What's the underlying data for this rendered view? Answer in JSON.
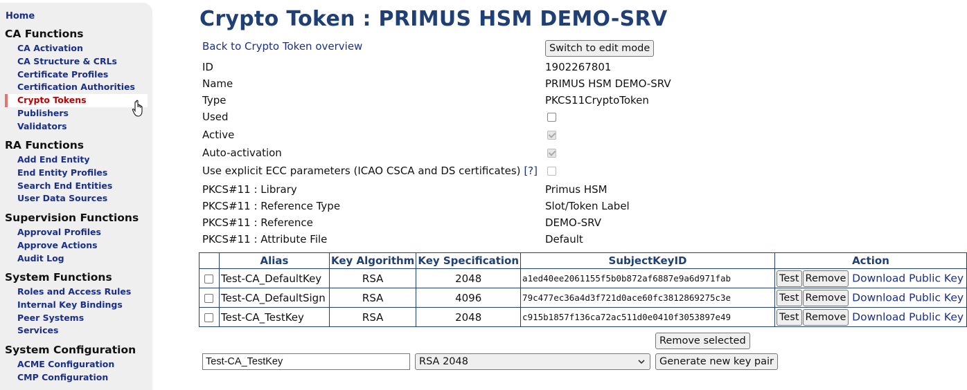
{
  "sidebar": {
    "home": "Home",
    "groups": [
      {
        "heading": "CA Functions",
        "items": [
          "CA Activation",
          "CA Structure & CRLs",
          "Certificate Profiles",
          "Certification Authorities",
          "Crypto Tokens",
          "Publishers",
          "Validators"
        ]
      },
      {
        "heading": "RA Functions",
        "items": [
          "Add End Entity",
          "End Entity Profiles",
          "Search End Entities",
          "User Data Sources"
        ]
      },
      {
        "heading": "Supervision Functions",
        "items": [
          "Approval Profiles",
          "Approve Actions",
          "Audit Log"
        ]
      },
      {
        "heading": "System Functions",
        "items": [
          "Roles and Access Rules",
          "Internal Key Bindings",
          "Peer Systems",
          "Services"
        ]
      },
      {
        "heading": "System Configuration",
        "items": [
          "ACME Configuration",
          "CMP Configuration"
        ]
      }
    ],
    "active_item": "Crypto Tokens"
  },
  "main": {
    "title": "Crypto Token : PRIMUS HSM DEMO-SRV",
    "back_link": "Back to Crypto Token overview",
    "edit_button": "Switch to edit mode",
    "properties": [
      {
        "label": "ID",
        "value": "1902267801"
      },
      {
        "label": "Name",
        "value": "PRIMUS HSM DEMO-SRV"
      },
      {
        "label": "Type",
        "value": "PKCS11CryptoToken"
      },
      {
        "label": "Used",
        "checked": false
      },
      {
        "label": "Active",
        "checked": true
      },
      {
        "label": "Auto-activation",
        "checked": true
      },
      {
        "label": "Use explicit ECC parameters (ICAO CSCA and DS certificates)",
        "help": "[?]",
        "checked": false
      },
      {
        "label": "PKCS#11 : Library",
        "value": "Primus HSM"
      },
      {
        "label": "PKCS#11 : Reference Type",
        "value": "Slot/Token Label"
      },
      {
        "label": "PKCS#11 : Reference",
        "value": "DEMO-SRV"
      },
      {
        "label": "PKCS#11 : Attribute File",
        "value": "Default"
      }
    ],
    "table": {
      "headers": [
        "Alias",
        "Key Algorithm",
        "Key Specification",
        "SubjectKeyID",
        "Action"
      ],
      "rows": [
        {
          "alias": "Test-CA_DefaultKey",
          "algorithm": "RSA",
          "spec": "2048",
          "skid": "a1ed40ee2061155f5b0b872af6887e9a6d971fab"
        },
        {
          "alias": "Test-CA_DefaultSign",
          "algorithm": "RSA",
          "spec": "4096",
          "skid": "79c477ec36a4d3f721d0ace60fc3812869275c3e"
        },
        {
          "alias": "Test-CA_TestKey",
          "algorithm": "RSA",
          "spec": "2048",
          "skid": "c915b1857f136ca72ac511d0e0410f3053897e49"
        }
      ],
      "test_label": "Test",
      "remove_label": "Remove",
      "download_label": "Download Public Key"
    },
    "remove_selected": "Remove selected",
    "new_key": {
      "alias_value": "Test-CA_TestKey",
      "algorithm_selected": "RSA 2048",
      "generate_button": "Generate new key pair"
    }
  }
}
